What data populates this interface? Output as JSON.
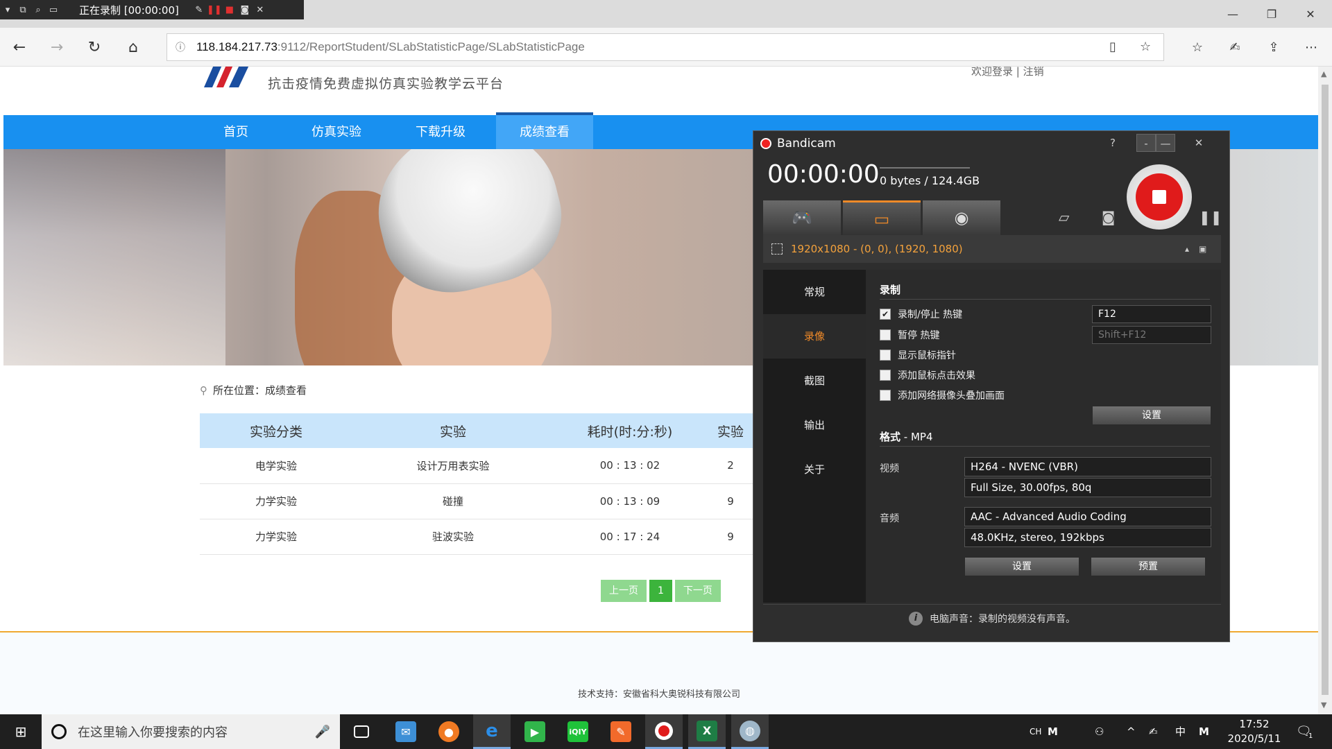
{
  "recorder_bar": {
    "title": "正在录制 [00:00:00]"
  },
  "browser": {
    "url_host": "118.184.217.73",
    "url_path": ":9112/ReportStudent/SLabStatisticPage/SLabStatisticPage"
  },
  "site": {
    "subtitle": "抗击疫情免费虚拟仿真实验教学云平台",
    "top_links": "欢迎登录 | 注销",
    "nav": [
      {
        "label": "首页"
      },
      {
        "label": "仿真实验"
      },
      {
        "label": "下载升级"
      },
      {
        "label": "成绩查看"
      }
    ],
    "breadcrumb_label": "所在位置：",
    "breadcrumb_value": "成绩查看",
    "table": {
      "headers": [
        "实验分类",
        "实验",
        "耗时(时:分:秒)",
        "实验"
      ],
      "rows": [
        [
          "电学实验",
          "设计万用表实验",
          "00 : 13 : 02",
          "2"
        ],
        [
          "力学实验",
          "碰撞",
          "00 : 13 : 09",
          "9"
        ],
        [
          "力学实验",
          "驻波实验",
          "00 : 17 : 24",
          "9"
        ]
      ]
    },
    "pagination": {
      "prev": "上一页",
      "current": "1",
      "next": "下一页"
    },
    "footer": "技术支持：安徽省科大奥锐科技有限公司"
  },
  "bandicam": {
    "title": "Bandicam",
    "help": "?",
    "timer": "00:00:00",
    "size": "0 bytes / 124.4GB",
    "region": "1920x1080 - (0, 0), (1920, 1080)",
    "tabs": [
      {
        "label": "常规"
      },
      {
        "label": "录像"
      },
      {
        "label": "截图"
      },
      {
        "label": "输出"
      },
      {
        "label": "关于"
      }
    ],
    "record_heading": "录制",
    "options": [
      {
        "label": "录制/停止 热键",
        "checked": true
      },
      {
        "label": "暂停 热键",
        "checked": false
      },
      {
        "label": "显示鼠标指针",
        "checked": false
      },
      {
        "label": "添加鼠标点击效果",
        "checked": false
      },
      {
        "label": "添加网络摄像头叠加画面",
        "checked": false
      }
    ],
    "hotkey_record": "F12",
    "hotkey_pause": "Shift+F12",
    "settings_btn": "设置",
    "format_heading": "格式",
    "format_value": " - MP4",
    "video_label": "视频",
    "video_codec": "H264 - NVENC (VBR)",
    "video_detail": "Full Size, 30.00fps, 80q",
    "audio_label": "音频",
    "audio_codec": "AAC - Advanced Audio Coding",
    "audio_detail": "48.0KHz, stereo, 192kbps",
    "settings_btn2": "设置",
    "preset_btn": "预置",
    "status": "电脑声音：录制的视频没有声音。"
  },
  "taskbar": {
    "search_placeholder": "在这里输入你要搜索的内容",
    "tray_lang": "CH",
    "tray_ime": "中",
    "time": "17:52",
    "date": "2020/5/11",
    "notif_count": "1"
  },
  "colors": {
    "nav_blue": "#1890f0",
    "accent_orange": "#f08a28",
    "rec_red": "#e01b1b"
  }
}
